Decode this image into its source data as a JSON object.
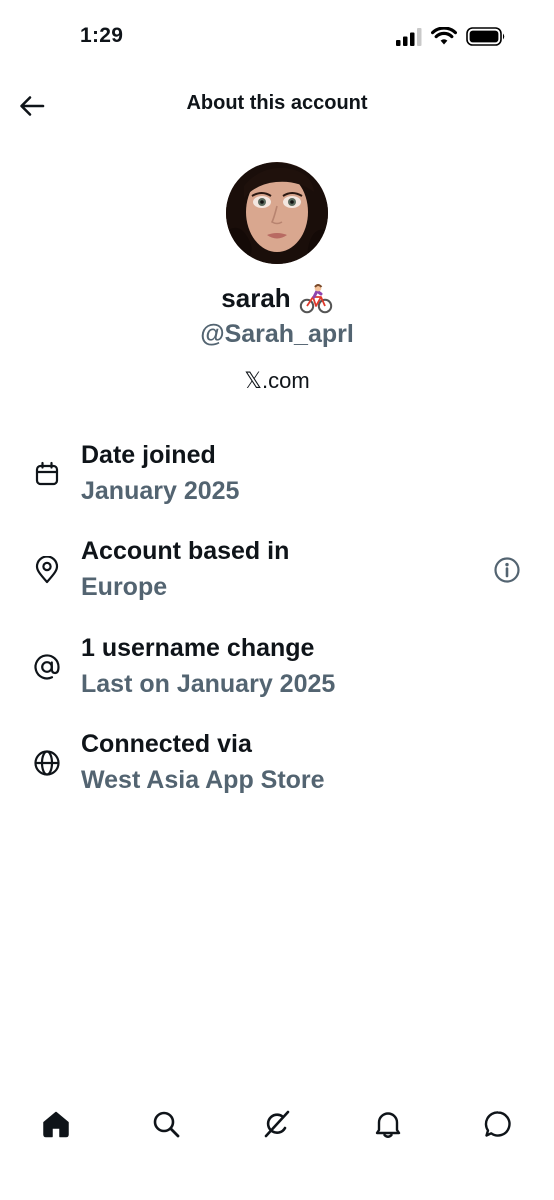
{
  "status_bar": {
    "time": "1:29",
    "icons": [
      "cellular-signal-icon",
      "wifi-icon",
      "battery-icon"
    ]
  },
  "header": {
    "title": "About this account",
    "back_icon": "back-arrow-icon"
  },
  "profile": {
    "display_name": "sarah",
    "name_emoji": "🚴‍♀️",
    "handle": "@Sarah_aprl",
    "site": "𝕏.com"
  },
  "details": [
    {
      "icon": "calendar-icon",
      "title": "Date joined",
      "value": "January 2025"
    },
    {
      "icon": "location-pin-icon",
      "title": "Account based in",
      "value": "Europe",
      "action_icon": "info-icon"
    },
    {
      "icon": "at-sign-icon",
      "title": "1 username change",
      "value": "Last on January 2025"
    },
    {
      "icon": "globe-icon",
      "title": "Connected via",
      "value": "West Asia App Store"
    }
  ],
  "tab_bar": {
    "tabs": [
      "home-icon",
      "search-icon",
      "grok-icon",
      "notifications-icon",
      "messages-icon"
    ],
    "active": "home"
  },
  "colors": {
    "text_primary": "#0f1419",
    "text_secondary": "#536471",
    "background": "#ffffff"
  }
}
